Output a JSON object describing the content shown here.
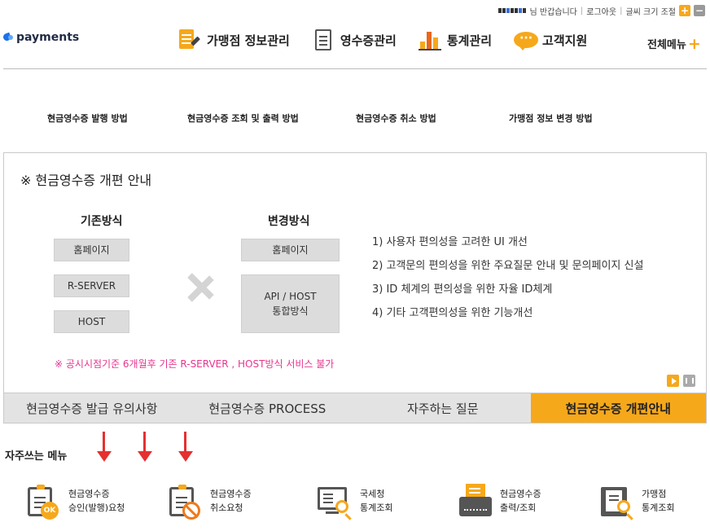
{
  "util": {
    "greeting": "님 반갑습니다",
    "logout": "로그아웃",
    "font_size": "글씨 크기 조절",
    "zoom_in": "+",
    "zoom_out": "−"
  },
  "logo": {
    "text": "payments"
  },
  "gnb": [
    {
      "label": "가맹점 정보관리",
      "icon": "store-info-icon"
    },
    {
      "label": "영수증관리",
      "icon": "receipt-icon"
    },
    {
      "label": "통계관리",
      "icon": "bar-chart-icon"
    },
    {
      "label": "고객지원",
      "icon": "chat-bubble-icon"
    }
  ],
  "all_menu": {
    "label": "전체메뉴",
    "plus": "+"
  },
  "guides": [
    "현금영수증 발행 방법",
    "현금영수증 조회 및 출력 방법",
    "현금영수증 취소 방법",
    "가맹점 정보 변경 방법"
  ],
  "notice": {
    "title": "※ 현금영수증 개편 안내",
    "old_head": "기존방식",
    "new_head": "변경방식",
    "old_items": [
      "홈페이지",
      "R-SERVER",
      "HOST"
    ],
    "new_items": [
      "홈페이지",
      "API / HOST",
      "통합방식"
    ],
    "points": [
      "1) 사용자 편의성을 고려한 UI 개선",
      "2) 고객문의 편의성을 위한 주요질문 안내 및 문의페이지 신설",
      "3) ID 체계의 편의성을 위한 자율 ID체계",
      "4) 기타 고객편의성을 위한 기능개선"
    ],
    "warning": "※ 공시시점기준 6개월후 기존 R-SERVER , HOST방식 서비스 불가"
  },
  "tabs": [
    {
      "label": "현금영수증 발급 유의사항",
      "active": false
    },
    {
      "label": "현금영수증 PROCESS",
      "active": false
    },
    {
      "label": "자주하는 질문",
      "active": false
    },
    {
      "label": "현금영수증 개편안내",
      "active": true
    }
  ],
  "favorites": {
    "label": "자주쓰는 메뉴",
    "items": [
      {
        "line1": "현금영수증",
        "line2": "승인(발행)요청",
        "icon": "approve-ok-icon",
        "badge": "OK"
      },
      {
        "line1": "현금영수증",
        "line2": "취소요청",
        "icon": "cancel-request-icon"
      },
      {
        "line1": "국세청",
        "line2": "통계조회",
        "icon": "monitor-search-icon"
      },
      {
        "line1": "현금영수증",
        "line2": "출력/조회",
        "icon": "printer-icon"
      },
      {
        "line1": "가맹점",
        "line2": "통계조회",
        "icon": "book-search-icon"
      }
    ]
  },
  "colors": {
    "accent": "#f6a81b",
    "warning_text": "#e8348e",
    "arrow": "#e53030"
  }
}
